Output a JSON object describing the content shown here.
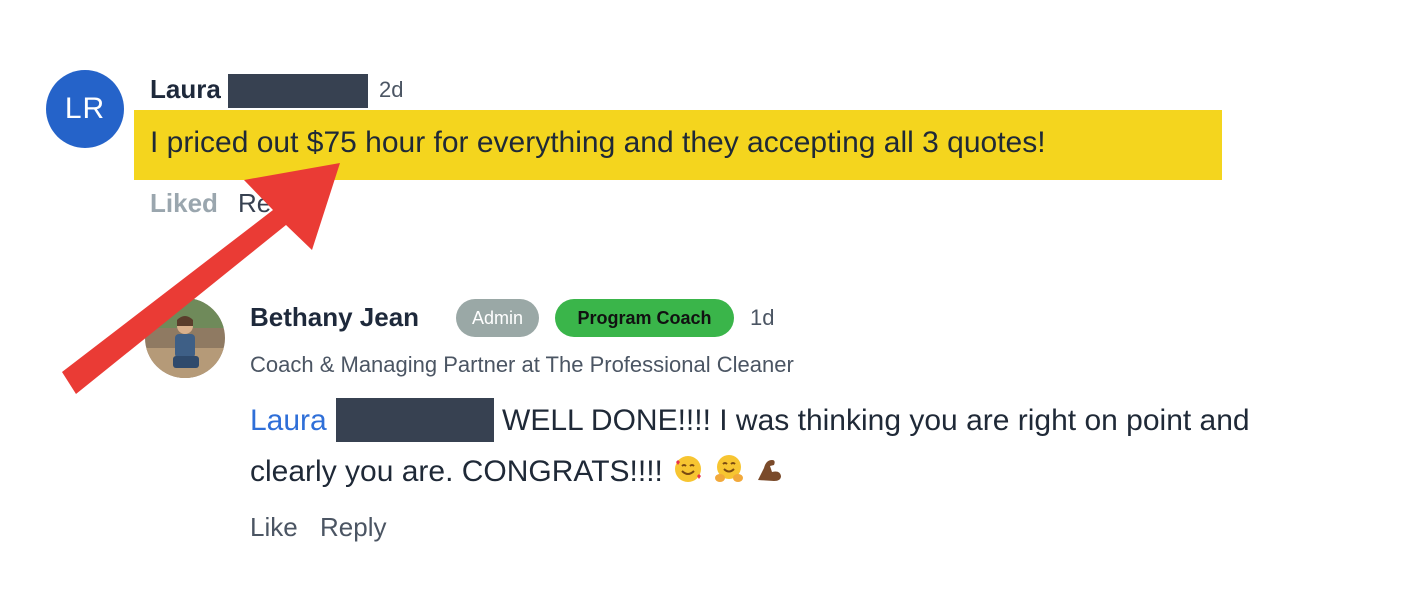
{
  "comment1": {
    "initials": "LR",
    "author_first": "Laura",
    "time": "2d",
    "body": "I priced out $75 hour for everything and they accepting all 3 quotes!",
    "liked_label": "Liked",
    "reply_label": "Re"
  },
  "comment2": {
    "author": "Bethany Jean",
    "badge_admin": "Admin",
    "badge_coach": "Program Coach",
    "time": "1d",
    "subtitle": "Coach & Managing Partner at The Professional Cleaner",
    "mention": "Laura",
    "body_line1": "WELL DONE!!!! I was thinking you are right on point and",
    "body_line2": "clearly you are. CONGRATS!!!!",
    "emojis": [
      "smiling-face-with-hearts-emoji",
      "hugging-face-emoji",
      "flexed-biceps-emoji"
    ],
    "like_label": "Like",
    "reply_label": "Reply"
  },
  "colors": {
    "avatar_blue": "#2563c9",
    "highlight_yellow": "#f4d51e",
    "arrow_red": "#ea3b35",
    "admin_badge": "#9aa8a6",
    "coach_badge": "#3ab54a",
    "mention_blue": "#2f6fd8",
    "redaction": "#374151"
  }
}
